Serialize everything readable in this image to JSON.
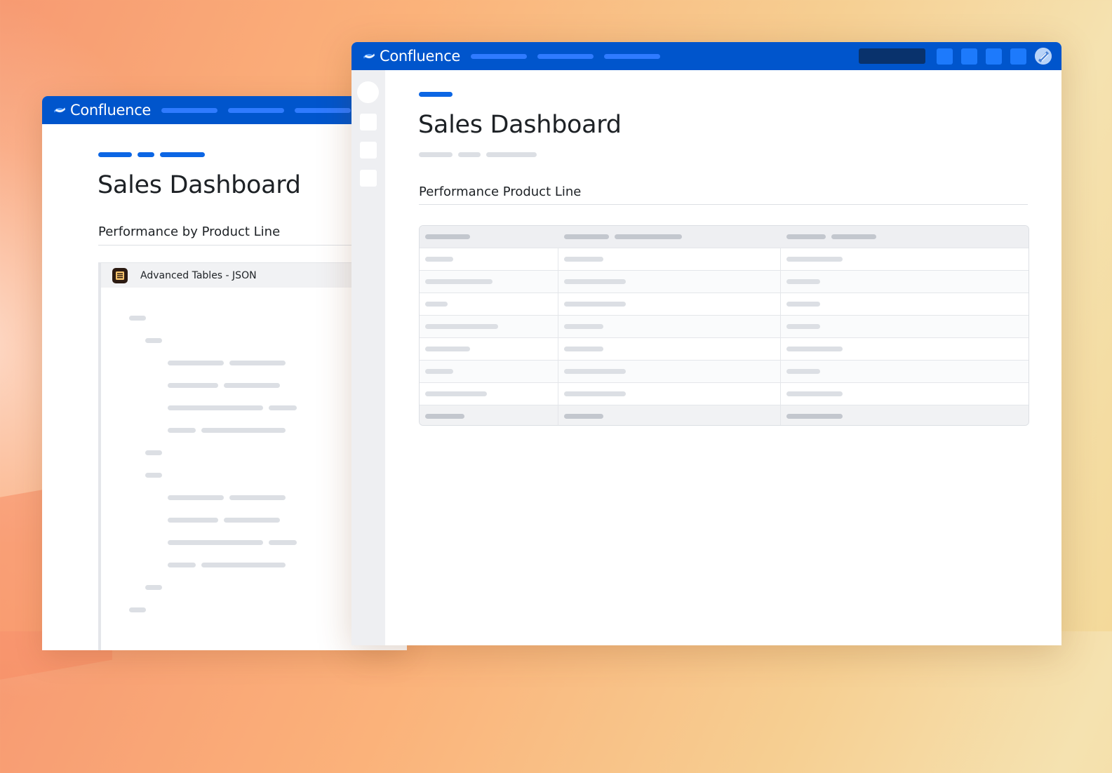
{
  "brand": {
    "name": "Confluence",
    "accent": "#0055cc"
  },
  "back_window": {
    "app_name": "Confluence",
    "page_title": "Sales Dashboard",
    "section_title": "Performance by Product Line",
    "macro": {
      "icon": "table-icon",
      "label": "Advanced Tables - JSON"
    }
  },
  "front_window": {
    "app_name": "Confluence",
    "page_title": "Sales Dashboard",
    "section_title": "Performance Product Line",
    "toolbar_icons": [
      "search-box",
      "notifications-icon",
      "help-icon",
      "settings-icon",
      "apps-icon",
      "user-avatar"
    ],
    "table": {
      "columns": 3,
      "body_rows": 7,
      "has_footer": true
    }
  }
}
